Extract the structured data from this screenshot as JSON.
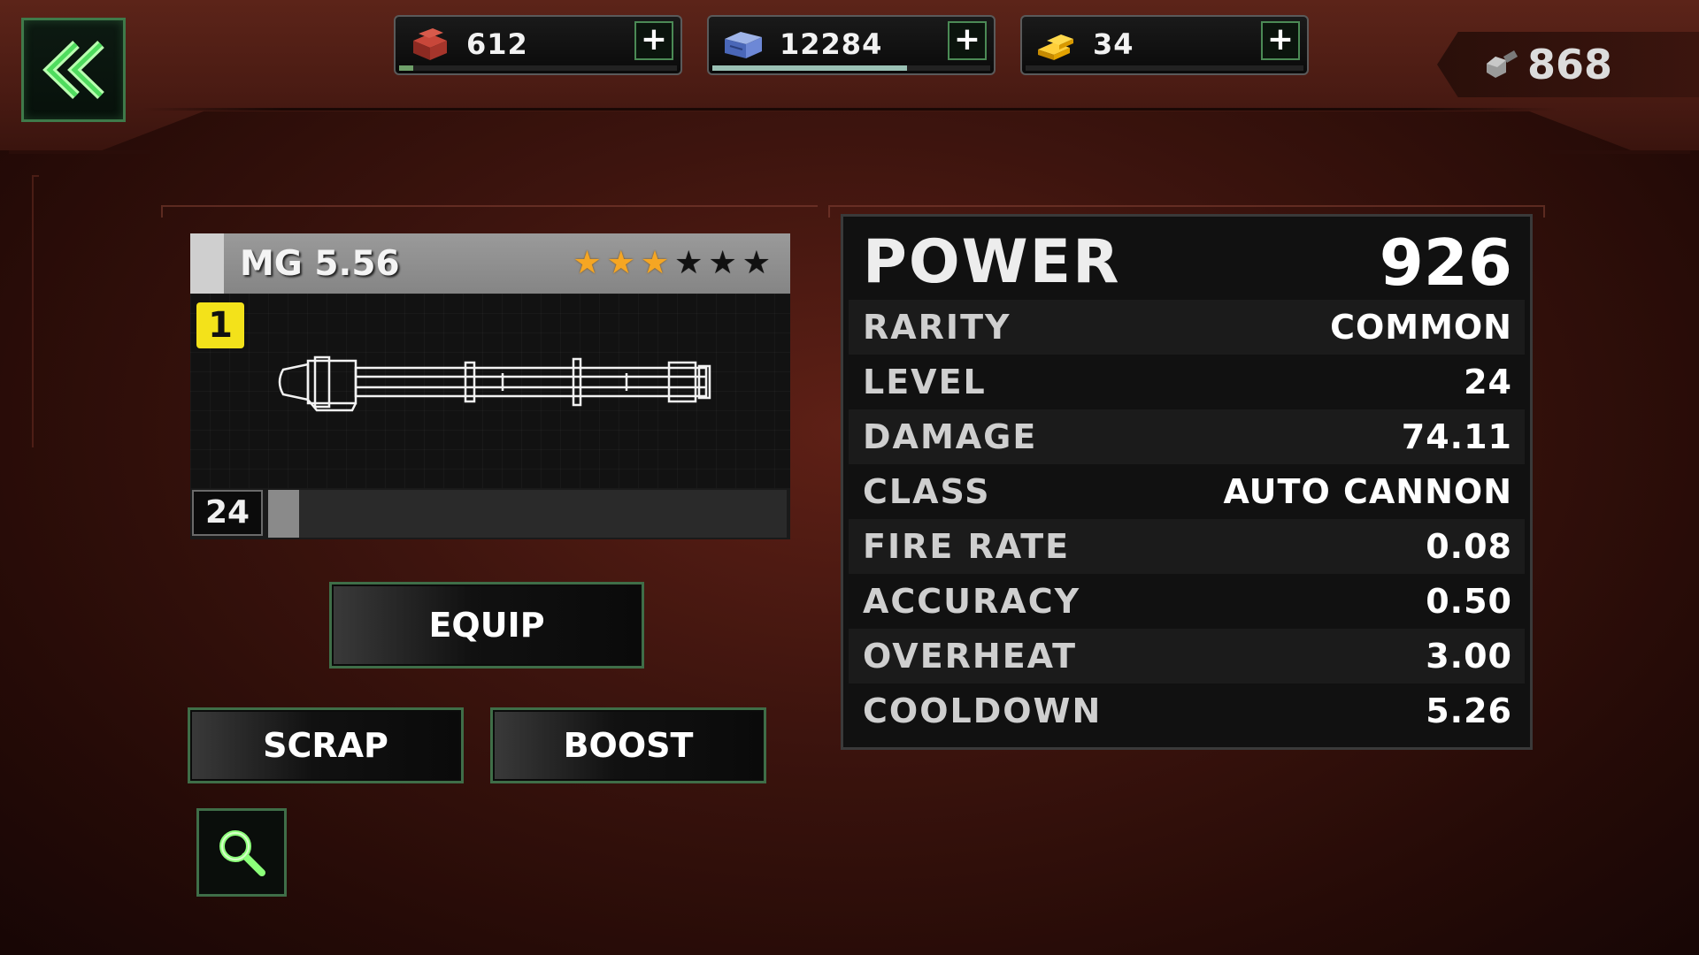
{
  "currencies": [
    {
      "icon": "iron-ingot-icon",
      "value": "612",
      "plus": "+",
      "bar_fill": 0.05
    },
    {
      "icon": "blue-crate-icon",
      "value": "12284",
      "plus": "+",
      "bar_fill": 0.7
    },
    {
      "icon": "gold-bars-icon",
      "value": "34",
      "plus": "+",
      "bar_fill": 0
    }
  ],
  "bolts": {
    "icon": "bolt-icon",
    "value": "868"
  },
  "weapon": {
    "name": "MG 5.56",
    "stars_total": 6,
    "stars_filled": 3,
    "tier": "1",
    "level": "24",
    "xp_fill": 0.06
  },
  "actions": {
    "equip": "EQUIP",
    "scrap": "SCRAP",
    "boost": "BOOST"
  },
  "stats": {
    "power_label": "POWER",
    "power_value": "926",
    "rows": [
      {
        "label": "RARITY",
        "value": "COMMON"
      },
      {
        "label": "LEVEL",
        "value": "24"
      },
      {
        "label": "DAMAGE",
        "value": "74.11"
      },
      {
        "label": "CLASS",
        "value": "AUTO CANNON"
      },
      {
        "label": "FIRE RATE",
        "value": "0.08"
      },
      {
        "label": "ACCURACY",
        "value": "0.50"
      },
      {
        "label": "OVERHEAT",
        "value": "3.00"
      },
      {
        "label": "COOLDOWN",
        "value": "5.26"
      }
    ]
  },
  "colors": {
    "accent_green": "#3f6e48",
    "star_gold": "#f5a623",
    "tier_yellow": "#f3e21a"
  }
}
